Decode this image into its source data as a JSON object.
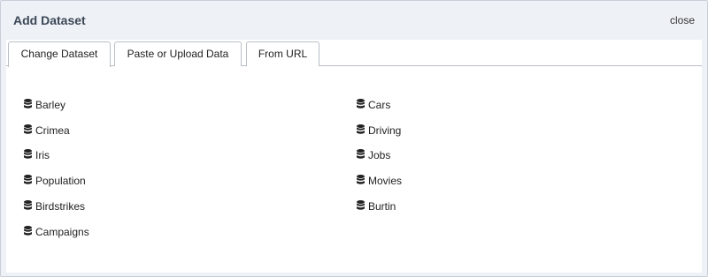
{
  "dialog": {
    "title": "Add Dataset",
    "close_label": "close"
  },
  "tabs": [
    {
      "label": "Change Dataset",
      "active": true
    },
    {
      "label": "Paste or Upload Data",
      "active": false
    },
    {
      "label": "From URL",
      "active": false
    }
  ],
  "datasets": {
    "left": [
      "Barley",
      "Crimea",
      "Iris",
      "Population",
      "Birdstrikes",
      "Campaigns"
    ],
    "right": [
      "Cars",
      "Driving",
      "Jobs",
      "Movies",
      "Burtin"
    ]
  },
  "icon": "database-icon",
  "colors": {
    "dialog_bg": "#eef1f6",
    "title_text": "#3b4756",
    "border": "#b9bec7"
  }
}
